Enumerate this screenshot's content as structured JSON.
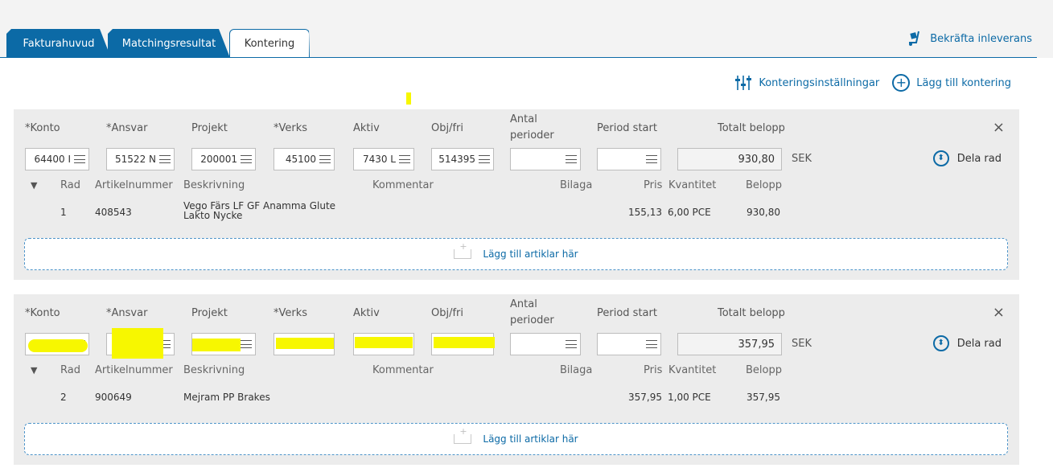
{
  "tabs": [
    {
      "label": "Fakturahuvud",
      "state": "dark"
    },
    {
      "label": "Matchingsresultat",
      "state": "dark"
    },
    {
      "label": "Kontering",
      "state": "active"
    }
  ],
  "header_actions": {
    "confirm_delivery": "Bekräfta inleverans",
    "settings": "Konteringsinställningar",
    "add_posting": "Lägg till kontering"
  },
  "columns": {
    "konto": "*Konto",
    "ansvar": "*Ansvar",
    "projekt": "Projekt",
    "verks": "*Verks",
    "aktiv": "Aktiv",
    "objfri": "Obj/fri",
    "antal_line1": "Antal",
    "antal_line2": "perioder",
    "period_start": "Period start",
    "totalt_belopp": "Totalt belopp"
  },
  "article_columns": {
    "rad": "Rad",
    "artikelnummer": "Artikelnummer",
    "beskrivning": "Beskrivning",
    "kommentar": "Kommentar",
    "bilaga": "Bilaga",
    "pris": "Pris",
    "kvantitet": "Kvantitet",
    "belopp": "Belopp"
  },
  "currency": "SEK",
  "split_label": "Dela rad",
  "dropzone_label": "Lägg till artiklar här",
  "close_symbol": "×",
  "rows": [
    {
      "konto": "64400 I",
      "ansvar": "51522 N",
      "projekt": "200001",
      "verks": "45100",
      "aktiv": "7430 L",
      "objfri": "514395",
      "total": "930,80",
      "article": {
        "rad": "1",
        "artikelnummer": "408543",
        "beskrivning_line1": "Vego Färs LF GF Anamma Glute",
        "beskrivning_line2": "Lakto Nycke",
        "pris": "155,13",
        "kvantitet": "6,00 PCE",
        "belopp": "930,80"
      }
    },
    {
      "konto": "",
      "ansvar": "",
      "projekt": "",
      "verks": "",
      "aktiv": "",
      "objfri": "",
      "total": "357,95",
      "article": {
        "rad": "2",
        "artikelnummer": "900649",
        "beskrivning_line1": "Mejram PP Brakes",
        "beskrivning_line2": "",
        "pris": "357,95",
        "kvantitet": "1,00 PCE",
        "belopp": "357,95"
      }
    }
  ],
  "colors": {
    "accent": "#0c6aa6",
    "redaction": "#f7f700",
    "panel": "#ececec"
  }
}
